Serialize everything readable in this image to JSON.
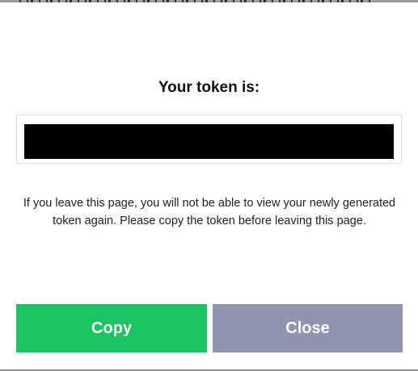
{
  "dialog": {
    "title": "Your token is:",
    "token_value": "",
    "notice": "If you leave this page, you will not be able to view your newly generated token again. Please copy the token before leaving this page.",
    "copy_label": "Copy",
    "close_label": "Close"
  },
  "colors": {
    "copy_button": "#1ac460",
    "close_button": "#8f95b0",
    "token_mask": "#000000"
  }
}
